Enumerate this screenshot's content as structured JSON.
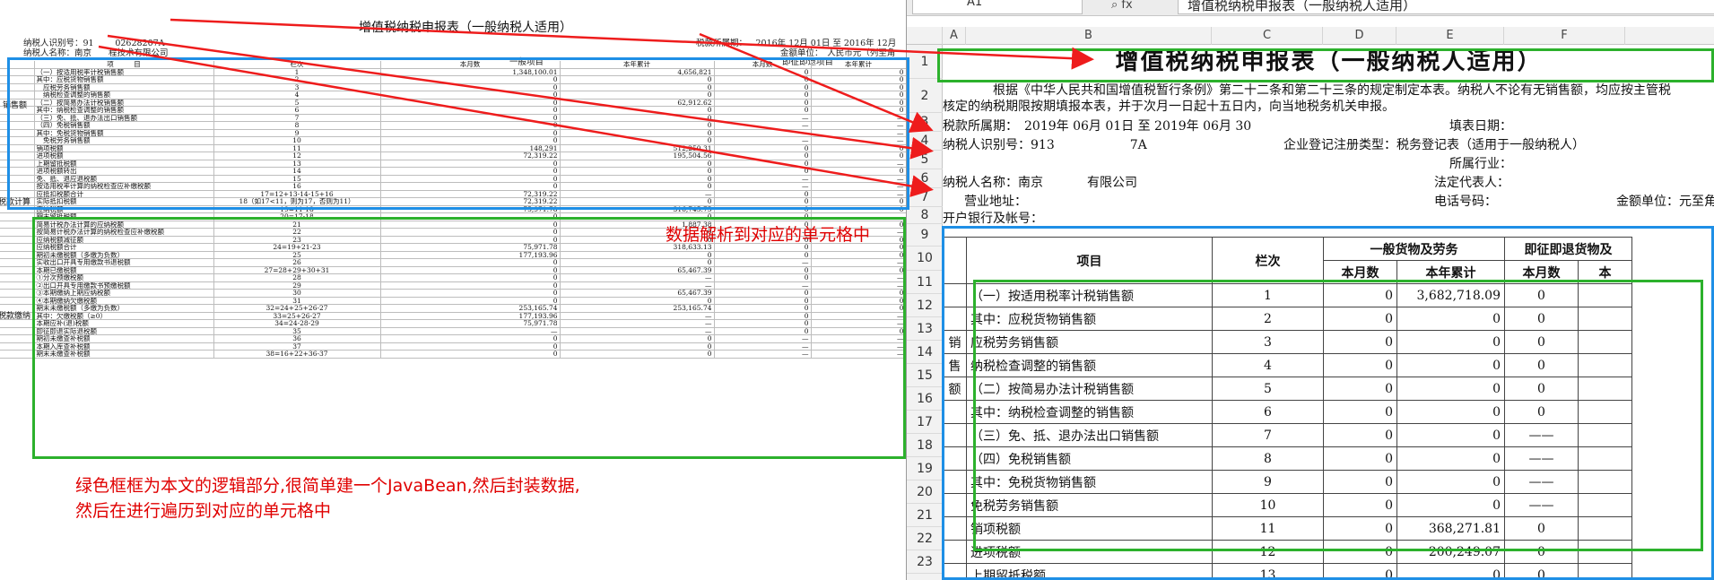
{
  "left": {
    "title": "增值税纳税申报表（一般纳税人适用）",
    "taxpayer_id": "纳税人识别号：91     02628207A",
    "taxpayer_name": "纳税人名称：南京    程技术有限公司",
    "period": "税款所属期：  2016年 12月 01日 至 2016年 12月",
    "currency": "金额单位： 人民币元（列至角",
    "head_col_project": "项   目",
    "head_col_no": "栏次",
    "head_general": "一般项目",
    "head_refund": "即征即退项目",
    "head_month": "本月数",
    "head_year": "本年累计",
    "side_sales": "销售额",
    "side_tax": "税款计算",
    "side_pay": "税款缴纳",
    "rows": [
      {
        "name": "（一）按适用税率计税销售额",
        "no": "1",
        "m": "1,348,100.01",
        "y": "4,656,821",
        "rm": "0",
        "ry": "0"
      },
      {
        "name": "其中：应税货物销售额",
        "no": "2",
        "m": "0",
        "y": "0",
        "rm": "0",
        "ry": "0"
      },
      {
        "name": " 应税劳务销售额",
        "no": "3",
        "m": "0",
        "y": "0",
        "rm": "0",
        "ry": "0"
      },
      {
        "name": " 纳税检查调整的销售额",
        "no": "4",
        "m": "0",
        "y": "0",
        "rm": "0",
        "ry": "0"
      },
      {
        "name": "（二）按简易办法计税销售额",
        "no": "5",
        "m": "0",
        "y": "62,912.62",
        "rm": "0",
        "ry": "0"
      },
      {
        "name": "其中：纳税检查调整的销售额",
        "no": "6",
        "m": "0",
        "y": "0",
        "rm": "0",
        "ry": "0"
      },
      {
        "name": "（三）免、抵、退办法出口销售额",
        "no": "7",
        "m": "0",
        "y": "0",
        "rm": "—",
        "ry": "—"
      },
      {
        "name": "（四）免税销售额",
        "no": "8",
        "m": "0",
        "y": "0",
        "rm": "—",
        "ry": "—"
      },
      {
        "name": "其中：免税货物销售额",
        "no": "9",
        "m": "0",
        "y": "0",
        "rm": "—",
        "ry": "—"
      },
      {
        "name": " 免税劳务销售额",
        "no": "10",
        "m": "0",
        "y": "0",
        "rm": "—",
        "ry": "—"
      },
      {
        "name": "销项税额",
        "no": "11",
        "m": "148,291",
        "y": "512,250.31",
        "rm": "0",
        "ry": "0"
      },
      {
        "name": "进项税额",
        "no": "12",
        "m": "72,319.22",
        "y": "195,504.56",
        "rm": "0",
        "ry": "0"
      },
      {
        "name": "上期留抵税额",
        "no": "13",
        "m": "0",
        "y": "0",
        "rm": "0",
        "ry": "—"
      },
      {
        "name": "进项税额转出",
        "no": "14",
        "m": "0",
        "y": "0",
        "rm": "0",
        "ry": "0"
      },
      {
        "name": "免、抵、退应退税额",
        "no": "15",
        "m": "0",
        "y": "0",
        "rm": "—",
        "ry": "—"
      },
      {
        "name": "按适用税率计算的纳税检查应补缴税额",
        "no": "16",
        "m": "0",
        "y": "0",
        "rm": "—",
        "ry": "—"
      },
      {
        "name": "应抵扣税额合计",
        "no": "17=12+13-14-15+16",
        "m": "72,319.22",
        "y": "—",
        "rm": "0",
        "ry": "—"
      },
      {
        "name": "实际抵扣税额",
        "no": "18（如17<11，则为17，否则为11）",
        "m": "72,319.22",
        "y": "0",
        "rm": "0",
        "ry": "0"
      },
      {
        "name": "应纳税额",
        "no": "19=11-18",
        "m": "75,971.78",
        "y": "316,745.75",
        "rm": "0",
        "ry": "0"
      },
      {
        "name": "期末留抵税额",
        "no": "20=17-18",
        "m": "0",
        "y": "0",
        "rm": "0",
        "ry": "—"
      },
      {
        "name": "简易计税办法计算的应纳税额",
        "no": "21",
        "m": "0",
        "y": "1,887.38",
        "rm": "0",
        "ry": "0"
      },
      {
        "name": "按简易计税办法计算的纳税检查应补缴税额",
        "no": "22",
        "m": "0",
        "y": "0",
        "rm": "—",
        "ry": "—"
      },
      {
        "name": "应纳税额减征额",
        "no": "23",
        "m": "0",
        "y": "0",
        "rm": "0",
        "ry": "0"
      },
      {
        "name": "应纳税额合计",
        "no": "24=19+21-23",
        "m": "75,971.78",
        "y": "318,633.13",
        "rm": "0",
        "ry": "0"
      },
      {
        "name": "期初未缴税额（多缴为负数）",
        "no": "25",
        "m": "177,193.96",
        "y": "0",
        "rm": "0",
        "ry": "0"
      },
      {
        "name": "实收出口开具专用缴款书退税额",
        "no": "26",
        "m": "0",
        "y": "0",
        "rm": "—",
        "ry": "—"
      },
      {
        "name": "本期已缴税额",
        "no": "27=28+29+30+31",
        "m": "0",
        "y": "65,467.39",
        "rm": "0",
        "ry": "0"
      },
      {
        "name": "①分次预缴税额",
        "no": "28",
        "m": "0",
        "y": "—",
        "rm": "0",
        "ry": "—"
      },
      {
        "name": "②出口开具专用缴款书预缴税额",
        "no": "29",
        "m": "0",
        "y": "—",
        "rm": "—",
        "ry": "—"
      },
      {
        "name": "③本期缴纳上期应纳税额",
        "no": "30",
        "m": "0",
        "y": "65,467.39",
        "rm": "0",
        "ry": "0"
      },
      {
        "name": "④本期缴纳欠缴税额",
        "no": "31",
        "m": "0",
        "y": "0",
        "rm": "0",
        "ry": "0"
      },
      {
        "name": "期末未缴税额（多缴为负数）",
        "no": "32=24+25+26-27",
        "m": "253,165.74",
        "y": "253,165.74",
        "rm": "0",
        "ry": "0"
      },
      {
        "name": "其中：欠缴税额（≥0）",
        "no": "33=25+26-27",
        "m": "177,193.96",
        "y": "—",
        "rm": "0",
        "ry": "—"
      },
      {
        "name": "本期应补(退)税额",
        "no": "34=24-28-29",
        "m": "75,971.78",
        "y": "—",
        "rm": "0",
        "ry": "—"
      },
      {
        "name": "即征即退实际退税额",
        "no": "35",
        "m": "—",
        "y": "—",
        "rm": "0",
        "ry": "0"
      },
      {
        "name": "期初未缴查补税额",
        "no": "36",
        "m": "0",
        "y": "0",
        "rm": "—",
        "ry": "—"
      },
      {
        "name": "本期入库查补税额",
        "no": "37",
        "m": "0",
        "y": "0",
        "rm": "—",
        "ry": "—"
      },
      {
        "name": "期末未缴查补税额",
        "no": "38=16+22+36-37",
        "m": "0",
        "y": "0",
        "rm": "—",
        "ry": "—"
      }
    ]
  },
  "right": {
    "name_box": "A1",
    "fx_label": "fx",
    "formula_value": "增值税纳税申报表（一般纳税人适用）",
    "columns": [
      "A",
      "B",
      "C",
      "D",
      "E",
      "F"
    ],
    "rows": [
      "1",
      "2",
      "3",
      "4",
      "5",
      "6",
      "7",
      "8",
      "9",
      "10",
      "11",
      "12",
      "13",
      "14",
      "15",
      "16",
      "17",
      "18",
      "19",
      "20",
      "21",
      "22",
      "23"
    ],
    "title": "增值税纳税申报表（一般纳税人适用）",
    "intro_line1": "根据《中华人民共和国增值税暂行条例》第二十二条和第二十三条的规定制定本表。纳税人不论有无销售额，均应按主管税",
    "intro_line2": "核定的纳税期限按期填报本表，并于次月一日起十五日内，向当地税务机关申报。",
    "period": "税款所属期： 2019年 06月 01日 至 2019年 06月 30",
    "fill_date": "填表日期：",
    "taxpayer_id": "纳税人识别号：913            7A",
    "reg_type": "企业登记注册类型：税务登记表（适用于一般纳税人）",
    "industry": "所属行业：",
    "taxpayer_name": "纳税人名称：南京       有限公司",
    "legal_rep": "法定代表人：",
    "address": "营业地址：",
    "phone": "电话号码：",
    "currency": "金额单位：元至角",
    "bank": "开户银行及帐号：",
    "head_project": "项目",
    "head_no": "栏次",
    "head_general": "一般货物及劳务",
    "head_refund": "即征即退货物及",
    "head_month": "本月数",
    "head_year": "本年累计",
    "side_sales": "销售额",
    "table_rows": [
      {
        "name": "（一）按适用税率计税销售额",
        "no": "1",
        "m": "0",
        "y": "3,682,718.09",
        "rm": "0"
      },
      {
        "name": "其中：应税货物销售额",
        "no": "2",
        "m": "0",
        "y": "0",
        "rm": "0"
      },
      {
        "name": "应税劳务销售额",
        "no": "3",
        "m": "0",
        "y": "0",
        "rm": "0"
      },
      {
        "name": "纳税检查调整的销售额",
        "no": "4",
        "m": "0",
        "y": "0",
        "rm": "0"
      },
      {
        "name": "（二）按简易办法计税销售额",
        "no": "5",
        "m": "0",
        "y": "0",
        "rm": "0"
      },
      {
        "name": "其中：纳税检查调整的销售额",
        "no": "6",
        "m": "0",
        "y": "0",
        "rm": "0"
      },
      {
        "name": "（三）免、抵、退办法出口销售额",
        "no": "7",
        "m": "0",
        "y": "0",
        "rm": "——"
      },
      {
        "name": "（四）免税销售额",
        "no": "8",
        "m": "0",
        "y": "0",
        "rm": "——"
      },
      {
        "name": "其中：免税货物销售额",
        "no": "9",
        "m": "0",
        "y": "0",
        "rm": "——"
      },
      {
        "name": "免税劳务销售额",
        "no": "10",
        "m": "0",
        "y": "0",
        "rm": "——"
      },
      {
        "name": "销项税额",
        "no": "11",
        "m": "0",
        "y": "368,271.81",
        "rm": "0"
      },
      {
        "name": "进项税额",
        "no": "12",
        "m": "0",
        "y": "200,249.07",
        "rm": "0"
      },
      {
        "name": "上期留抵税额",
        "no": "13",
        "m": "0",
        "y": "0",
        "rm": "0"
      }
    ]
  },
  "annotations": {
    "parse_note": "数据解析到对应的单元格中",
    "green_note_line1": "绿色框框为本文的逻辑部分,很简单建一个JavaBean,然后封装数据,",
    "green_note_line2": "然后在进行遍历到对应的单元格中"
  },
  "colors": {
    "arrow": "#ee1c1c",
    "blue_box": "#1e8fe6",
    "green_box": "#2cb12c",
    "annotation": "#e00000"
  }
}
